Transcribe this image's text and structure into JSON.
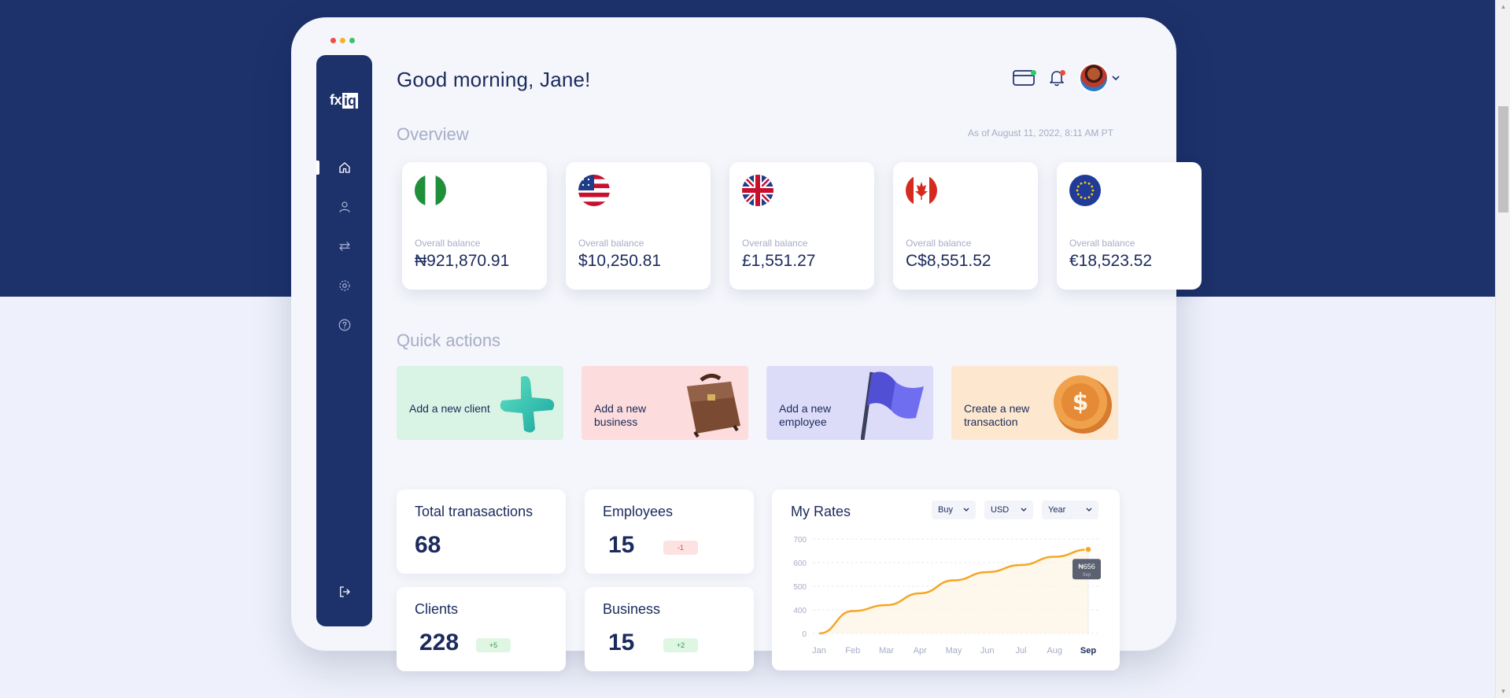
{
  "header": {
    "greeting": "Good morning, Jane!"
  },
  "brand": {
    "logo_fx": "fx",
    "logo_iq": "iq"
  },
  "overview": {
    "title": "Overview",
    "as_of": "As of August 11, 2022, 8:11 AM PT",
    "balances": [
      {
        "flag": "nigeria-flag-icon",
        "label": "Overall balance",
        "value": "₦921,870.91"
      },
      {
        "flag": "us-flag-icon",
        "label": "Overall balance",
        "value": "$10,250.81"
      },
      {
        "flag": "uk-flag-icon",
        "label": "Overall balance",
        "value": "£1,551.27"
      },
      {
        "flag": "canada-flag-icon",
        "label": "Overall balance",
        "value": "C$8,551.52"
      },
      {
        "flag": "eu-flag-icon",
        "label": "Overall balance",
        "value": "€18,523.52"
      }
    ]
  },
  "quick_actions": {
    "title": "Quick actions",
    "items": [
      {
        "label": "Add a new client",
        "color": "#d9f3e4",
        "icon": "plus-icon"
      },
      {
        "label": "Add a new business",
        "color": "#fcdcdc",
        "icon": "briefcase-icon"
      },
      {
        "label": "Add a new employee",
        "color": "#dcdcf9",
        "icon": "flag-icon"
      },
      {
        "label": "Create a new transaction",
        "color": "#fde8cf",
        "icon": "coin-icon"
      }
    ]
  },
  "stats": {
    "total_transactions": {
      "title": "Total tranasactions",
      "value": "68"
    },
    "employees": {
      "title": "Employees",
      "value": "15",
      "delta": "-1"
    },
    "clients": {
      "title": "Clients",
      "value": "228",
      "delta": "+5"
    },
    "business": {
      "title": "Business",
      "value": "15",
      "delta": "+2"
    }
  },
  "rates": {
    "title": "My Rates",
    "filters": {
      "side": "Buy",
      "currency": "USD",
      "period": "Year"
    },
    "tooltip": {
      "value": "₦656",
      "sub": "Sep"
    }
  },
  "colors": {
    "navy": "#1d316b",
    "accent_line": "#f5a623",
    "positive_pill_bg": "#dff6e3",
    "positive_pill_text": "#2e9e4a",
    "negative_pill_bg": "#fde2e2",
    "negative_pill_text": "#d94a4a"
  },
  "chart_data": {
    "type": "line",
    "title": "My Rates",
    "categories": [
      "Jan",
      "Feb",
      "Mar",
      "Apr",
      "May",
      "Jun",
      "Jul",
      "Aug",
      "Sep"
    ],
    "y_ticks": [
      "700",
      "600",
      "500",
      "400",
      "0"
    ],
    "series": [
      {
        "values": [
          0,
          380,
          420,
          470,
          525,
          560,
          590,
          625,
          656
        ]
      }
    ],
    "highlight": {
      "category": "Sep",
      "label": "₦656"
    },
    "grid": true
  }
}
